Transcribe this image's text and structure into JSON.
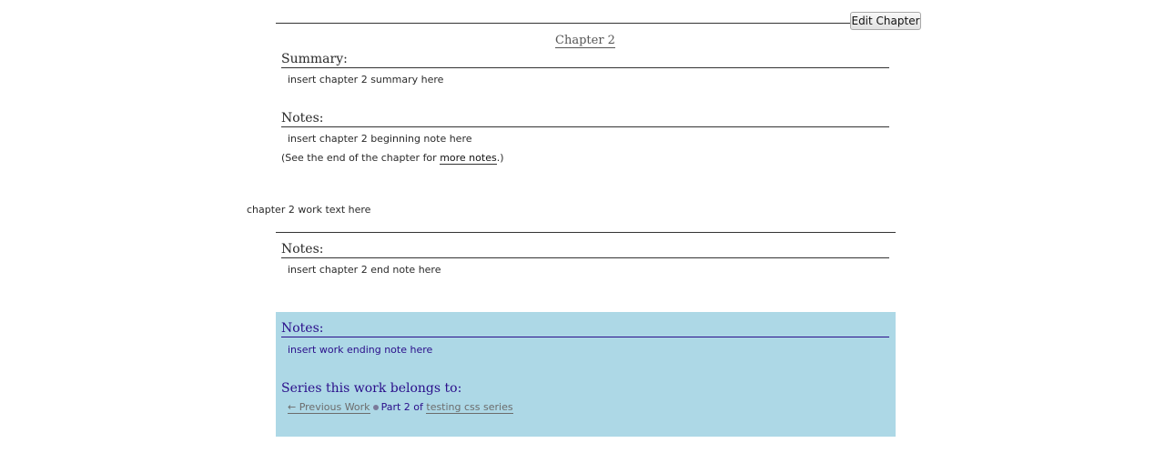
{
  "toolbar": {
    "edit_label": "Edit Chapter"
  },
  "chapter": {
    "title": "Chapter 2",
    "summary_heading": "Summary:",
    "summary_text": "insert chapter 2 summary here",
    "notes_heading": "Notes:",
    "beginning_note": "insert chapter 2 beginning note here",
    "see_end_prefix": "(See the end of the chapter for ",
    "see_end_link": "more notes",
    "see_end_suffix": ".)",
    "work_text": "chapter 2 work text here",
    "end_notes_heading": "Notes:",
    "end_note": "insert chapter 2 end note here"
  },
  "afterword": {
    "notes_heading": "Notes:",
    "work_end_note": "insert work ending note here",
    "series_heading": "Series this work belongs to:",
    "previous_label": "← Previous Work",
    "part_label": "Part 2 of ",
    "series_name": "testing css series"
  },
  "colors": {
    "afterword_bg": "#add8e6",
    "afterword_text": "#2a0e8a"
  }
}
